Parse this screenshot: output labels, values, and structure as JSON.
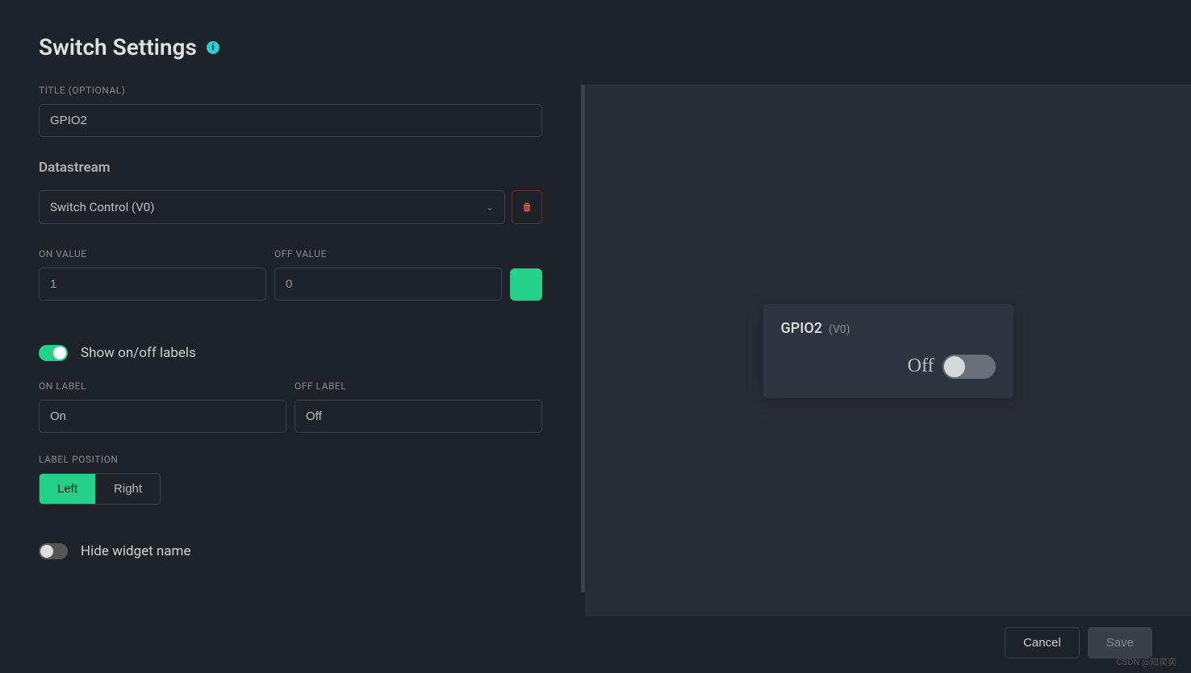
{
  "header": {
    "title": "Switch Settings",
    "info_icon": "i"
  },
  "form": {
    "title_label": "TITLE (OPTIONAL)",
    "title_value": "GPIO2",
    "datastream_heading": "Datastream",
    "datastream_value": "Switch Control (V0)",
    "on_value_label": "ON VALUE",
    "on_value": "1",
    "off_value_label": "OFF VALUE",
    "off_value": "0",
    "color_value": "#23d18b",
    "show_labels_toggle_label": "Show on/off labels",
    "show_labels_toggle_on": true,
    "on_label_label": "ON LABEL",
    "on_label_value": "On",
    "off_label_label": "OFF LABEL",
    "off_label_value": "Off",
    "label_position_label": "LABEL POSITION",
    "label_position_options": [
      "Left",
      "Right"
    ],
    "label_position_selected": "Left",
    "hide_widget_toggle_label": "Hide widget name",
    "hide_widget_toggle_on": false
  },
  "preview": {
    "title": "GPIO2",
    "subtitle": "(V0)",
    "state_label": "Off"
  },
  "footer": {
    "cancel": "Cancel",
    "save": "Save"
  },
  "watermark": "CSDN @知奕奕"
}
